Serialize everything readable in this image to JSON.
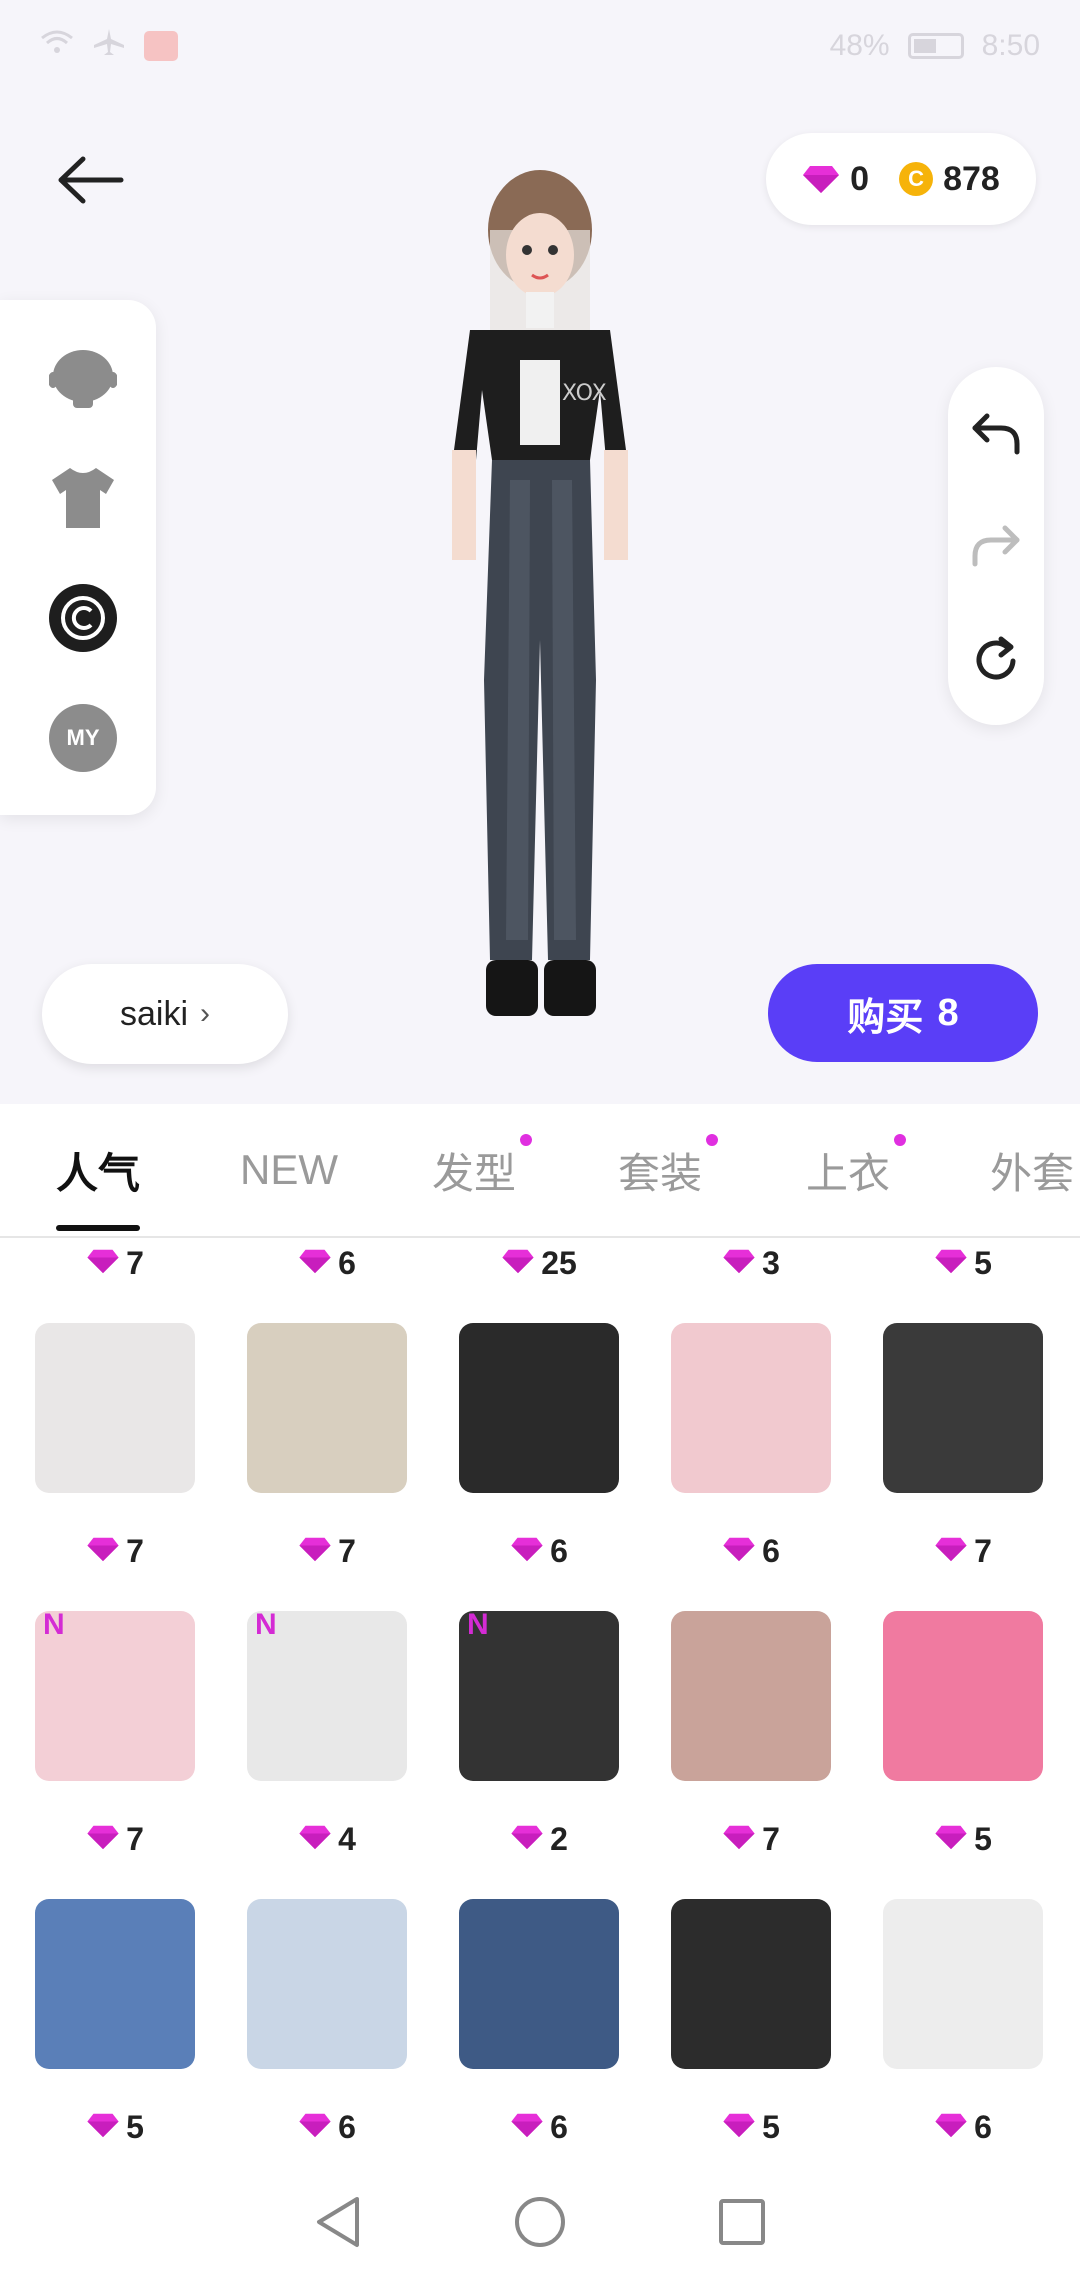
{
  "status_bar": {
    "battery": "48%",
    "time": "8:50"
  },
  "currency": {
    "gems": "0",
    "coins": "878",
    "coin_glyph": "C"
  },
  "left_panel": {
    "my_label": "MY"
  },
  "name_pill": {
    "name": "saiki",
    "chevron": "›"
  },
  "buy_button": {
    "label": "购买",
    "count": "8"
  },
  "tabs": [
    {
      "label": "人气",
      "active": true,
      "dot": false
    },
    {
      "label": "NEW",
      "active": false,
      "dot": false
    },
    {
      "label": "发型",
      "active": false,
      "dot": true
    },
    {
      "label": "套装",
      "active": false,
      "dot": true
    },
    {
      "label": "上衣",
      "active": false,
      "dot": true
    },
    {
      "label": "外套",
      "active": false,
      "dot": false
    }
  ],
  "grid": {
    "badge": "N",
    "prices": [
      [
        "7",
        "6",
        "25",
        "3",
        "5"
      ],
      [
        "7",
        "7",
        "6",
        "6",
        "7"
      ],
      [
        "7",
        "4",
        "2",
        "7",
        "5"
      ],
      [
        "5",
        "6",
        "6",
        "5",
        "6"
      ]
    ],
    "items": [
      [
        {
          "icon": "white-wavy-hair",
          "color": "#e9e7e7",
          "new": false
        },
        {
          "icon": "blonde-bun-hair",
          "color": "#d8cfbf",
          "new": false
        },
        {
          "icon": "black-heels",
          "color": "#2a2a2a",
          "new": false
        },
        {
          "icon": "pink-skirt-outfit",
          "color": "#f1c9cf",
          "new": false
        },
        {
          "icon": "black-bun-hair",
          "color": "#3a3a3a",
          "new": false
        }
      ],
      [
        {
          "icon": "pink-long-hair",
          "color": "#f3cfd6",
          "new": true
        },
        {
          "icon": "white-sandals",
          "color": "#e8e8e8",
          "new": true
        },
        {
          "icon": "black-sneakers",
          "color": "#333333",
          "new": true
        },
        {
          "icon": "eye-makeup",
          "color": "#c9a39a",
          "new": false
        },
        {
          "icon": "pink-striped-top",
          "color": "#f07aa0",
          "new": false
        }
      ],
      [
        {
          "icon": "denim-shorts",
          "color": "#5a7fb8",
          "new": false
        },
        {
          "icon": "floral-kimono",
          "color": "#c9d6e6",
          "new": false
        },
        {
          "icon": "dark-jeans",
          "color": "#3e5a85",
          "new": false
        },
        {
          "icon": "black-high-tops",
          "color": "#2c2c2c",
          "new": false
        },
        {
          "icon": "white-crop-outfit",
          "color": "#ededed",
          "new": false
        }
      ]
    ]
  },
  "colors": {
    "accent": "#5a3ef7",
    "gem": "#e62fd8",
    "coin": "#f6b30a"
  }
}
